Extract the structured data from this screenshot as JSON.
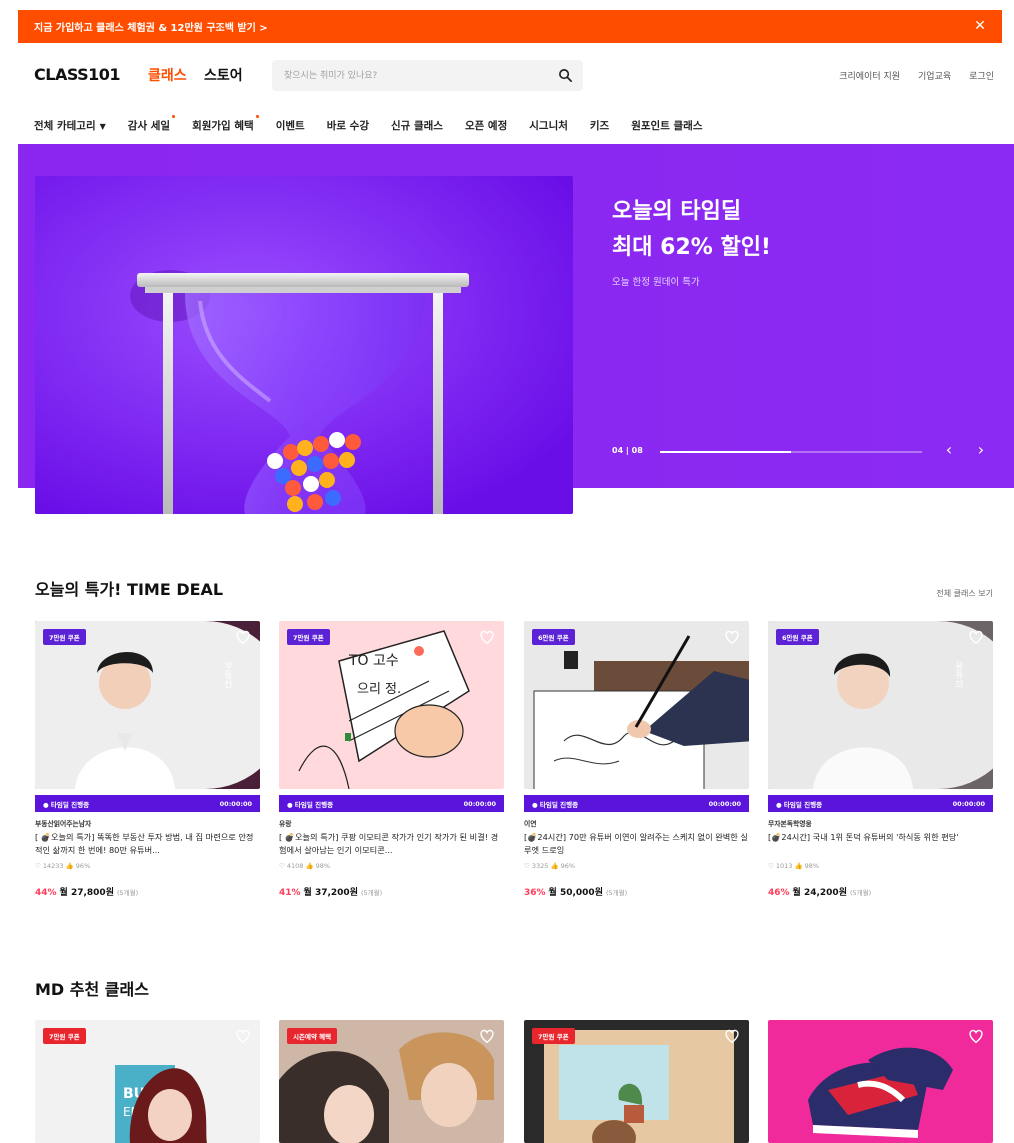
{
  "promo": {
    "text": "지금 가입하고 클래스 체험권 & 12만원 구조백 받기 >",
    "close_icon": "close-icon"
  },
  "header": {
    "logo": "CLASS101",
    "nav_class": "클래스",
    "nav_store": "스토어",
    "search_placeholder": "찾으시는 취미가 있나요?",
    "links": [
      "크리에이터 지원",
      "기업교육",
      "로그인"
    ]
  },
  "category_nav": {
    "all_label": "전체 카테고리",
    "items": [
      {
        "label": "감사 세일",
        "dot": true
      },
      {
        "label": "회원가입 혜택",
        "dot": true
      },
      {
        "label": "이벤트",
        "dot": false
      },
      {
        "label": "바로 수강",
        "dot": false
      },
      {
        "label": "신규 클래스",
        "dot": false
      },
      {
        "label": "오픈 예정",
        "dot": false
      },
      {
        "label": "시그니처",
        "dot": false
      },
      {
        "label": "키즈",
        "dot": false
      },
      {
        "label": "원포인트 클래스",
        "dot": false
      }
    ]
  },
  "hero": {
    "title_line1": "오늘의 타임딜",
    "title_line2": "최대 62% 할인!",
    "subtitle": "오늘 한정 원데이 특가",
    "counter": "04 | 08",
    "progress": 0.5,
    "background_color": "#8a26f0"
  },
  "time_deal": {
    "title": "오늘의 특가! TIME DEAL",
    "see_all": "전체 클래스 보기",
    "cards": [
      {
        "coupon": "7만원 쿠폰",
        "timer_label": "● 타임딜 진행중",
        "timer": "00:00:00",
        "creator": "부동산읽어주는남자",
        "title": "[ 💣오늘의 특가] 똑똑한 부동산 투자 방법, 내 집 마련으로 안정적인 삶까지 한 번에! 80만 유튜버...",
        "stats": "♡ 14233  👍 96%",
        "discount": "44%",
        "price": "월 27,800원",
        "months": "(5개월)"
      },
      {
        "coupon": "7만원 쿠폰",
        "timer_label": "● 타임딜 진행중",
        "timer": "00:00:00",
        "creator": "유랑",
        "title": "[ 💣오늘의 특가] 쿠팡 이모티콘 작가가 인기 작가가 된 비결! 경험에서 살아남는 인기 이모티콘...",
        "stats": "♡ 4108  👍 98%",
        "discount": "41%",
        "price": "월 37,200원",
        "months": "(5개월)"
      },
      {
        "coupon": "6만원 쿠폰",
        "timer_label": "● 타임딜 진행중",
        "timer": "00:00:00",
        "creator": "이연",
        "title": "[💣24시간] 70만 유튜버 이연이 알려주는 스케치 없이 완벽한 실루엣 드로잉",
        "stats": "♡ 3325  👍 96%",
        "discount": "36%",
        "price": "월 50,000원",
        "months": "(5개월)"
      },
      {
        "coupon": "6만원 쿠폰",
        "timer_label": "● 타임딜 진행중",
        "timer": "00:00:00",
        "creator": "무자본독학영웅",
        "title": "[💣24시간] 국내 1위 돈덕 유튜버의 '하식동 위한 편당'",
        "stats": "♡ 1013  👍 98%",
        "discount": "46%",
        "price": "월 24,200원",
        "months": "(5개월)"
      }
    ]
  },
  "md": {
    "title": "MD 추천 클래스",
    "cards": [
      {
        "coupon": "7만원 쿠폰"
      },
      {
        "coupon": "시즌예약 혜택"
      },
      {
        "coupon": "7만원 쿠폰"
      },
      {
        "coupon": ""
      }
    ]
  }
}
